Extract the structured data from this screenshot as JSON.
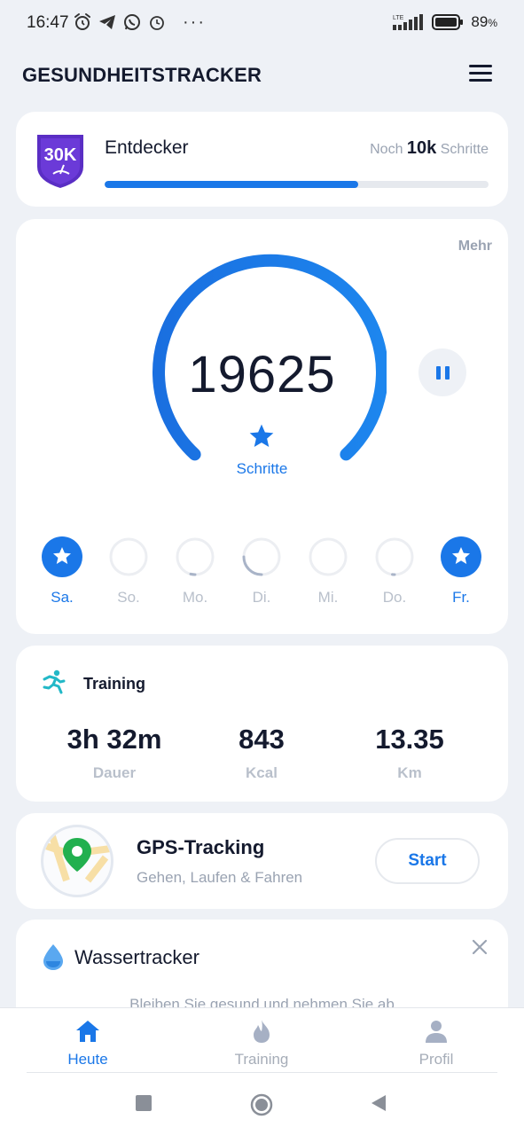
{
  "status_bar": {
    "time": "16:47",
    "dots": "···",
    "network": "LTE",
    "battery": "89",
    "battery_unit": "%"
  },
  "header": {
    "title": "GESUNDHEITSTRACKER"
  },
  "level": {
    "badge_text": "30K",
    "name": "Entdecker",
    "remaining_prefix": "Noch",
    "remaining_value": "10k",
    "remaining_suffix": "Schritte",
    "progress": 0.66,
    "color": "#1a77e8"
  },
  "steps": {
    "more_label": "Mehr",
    "value": "19625",
    "label": "Schritte",
    "days": [
      {
        "label": "Sa.",
        "status": "complete",
        "fraction": 1.0
      },
      {
        "label": "So.",
        "status": "empty",
        "fraction": 0.0
      },
      {
        "label": "Mo.",
        "status": "partial",
        "fraction": 0.04
      },
      {
        "label": "Di.",
        "status": "partial",
        "fraction": 0.25
      },
      {
        "label": "Mi.",
        "status": "empty",
        "fraction": 0.0
      },
      {
        "label": "Do.",
        "status": "partial",
        "fraction": 0.02
      },
      {
        "label": "Fr.",
        "status": "complete",
        "fraction": 1.0
      }
    ]
  },
  "training": {
    "title": "Training",
    "stats": [
      {
        "value": "3h 32m",
        "label": "Dauer"
      },
      {
        "value": "843",
        "label": "Kcal"
      },
      {
        "value": "13.35",
        "label": "Km"
      }
    ]
  },
  "gps": {
    "title": "GPS-Tracking",
    "subtitle": "Gehen, Laufen & Fahren",
    "button": "Start"
  },
  "water": {
    "title": "Wassertracker",
    "subtitle": "Bleiben Sie gesund und nehmen Sie ab"
  },
  "bottom_nav": {
    "items": [
      {
        "label": "Heute",
        "icon": "home-icon",
        "active": true
      },
      {
        "label": "Training",
        "icon": "flame-icon",
        "active": false
      },
      {
        "label": "Profil",
        "icon": "person-icon",
        "active": false
      }
    ]
  },
  "colors": {
    "accent": "#1a77e8",
    "inactive": "#b9c0cb"
  }
}
